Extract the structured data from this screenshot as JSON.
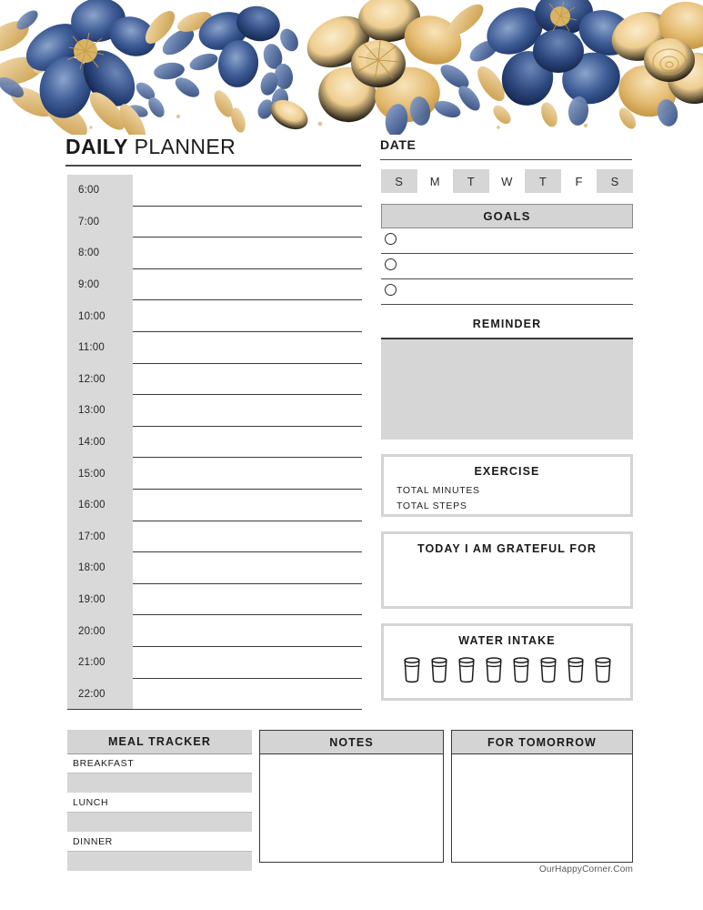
{
  "header": {
    "title_bold": "DAILY",
    "title_light": " PLANNER",
    "date_label": "DATE",
    "floral_colors": {
      "navy_dark": "#1f3a6e",
      "navy_mid": "#3c5a94",
      "navy_light": "#7b95c4",
      "gold_dark": "#c79a3f",
      "gold_mid": "#e3bb6e",
      "gold_light": "#f2d9a4"
    }
  },
  "days": [
    {
      "letter": "S",
      "filled": true
    },
    {
      "letter": "M",
      "filled": false
    },
    {
      "letter": "T",
      "filled": true
    },
    {
      "letter": "W",
      "filled": false
    },
    {
      "letter": "T",
      "filled": true
    },
    {
      "letter": "F",
      "filled": false
    },
    {
      "letter": "S",
      "filled": true
    }
  ],
  "schedule": {
    "hours": [
      "6:00",
      "7:00",
      "8:00",
      "9:00",
      "10:00",
      "11:00",
      "12:00",
      "13:00",
      "14:00",
      "15:00",
      "16:00",
      "17:00",
      "18:00",
      "19:00",
      "20:00",
      "21:00",
      "22:00"
    ]
  },
  "goals": {
    "title": "GOALS",
    "rows": [
      "",
      "",
      ""
    ]
  },
  "reminder": {
    "title": "REMINDER",
    "value": ""
  },
  "exercise": {
    "title": "EXERCISE",
    "total_minutes_label": "TOTAL MINUTES",
    "total_steps_label": "TOTAL STEPS",
    "total_minutes_value": "",
    "total_steps_value": ""
  },
  "grateful": {
    "title": "TODAY I AM GRATEFUL FOR",
    "value": ""
  },
  "water": {
    "title": "WATER INTAKE",
    "glass_count": 8,
    "glasses_filled": 0
  },
  "meal_tracker": {
    "title": "MEAL TRACKER",
    "meals": [
      "BREAKFAST",
      "LUNCH",
      "DINNER"
    ]
  },
  "notes": {
    "title": "NOTES",
    "value": ""
  },
  "tomorrow": {
    "title": "FOR TOMORROW",
    "value": ""
  },
  "footer": {
    "text": "OurHappyCorner.Com"
  },
  "theme": {
    "gray_fill": "#d6d6d6",
    "gray_header": "#d4d4d4",
    "rule_dark": "#3a3a3a",
    "text": "#1a1a1a"
  }
}
